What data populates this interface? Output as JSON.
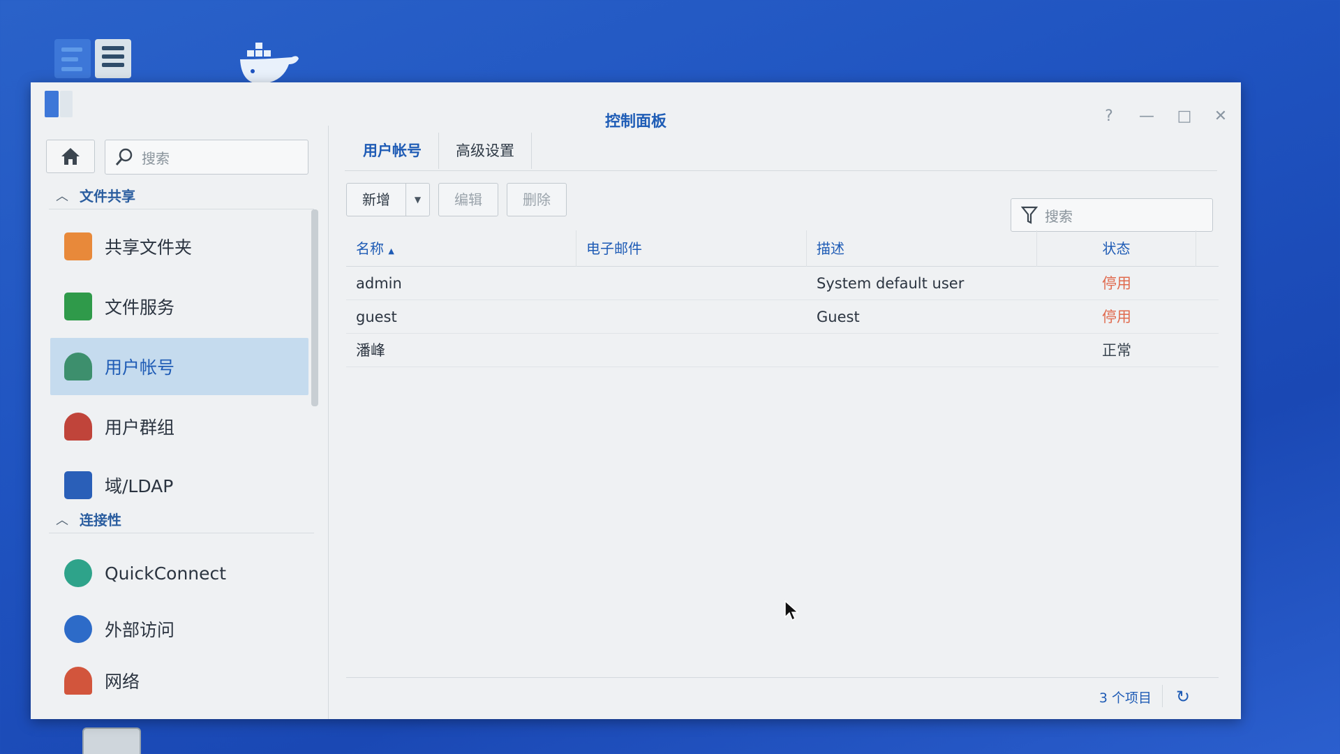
{
  "window": {
    "title": "控制面板"
  },
  "sidebar": {
    "search_placeholder": "搜索",
    "sections": [
      {
        "label": "文件共享"
      },
      {
        "label": "连接性"
      }
    ],
    "items": [
      {
        "label": "共享文件夹",
        "icon": "shared-folder-icon",
        "color": "#e8893a"
      },
      {
        "label": "文件服务",
        "icon": "file-services-icon",
        "color": "#2f9a4a"
      },
      {
        "label": "用户帐号",
        "icon": "user-icon",
        "color": "#3d8f6d",
        "active": true
      },
      {
        "label": "用户群组",
        "icon": "user-group-icon",
        "color": "#c0443a"
      },
      {
        "label": "域/LDAP",
        "icon": "ldap-icon",
        "color": "#2a5fb8"
      },
      {
        "label": "QuickConnect",
        "icon": "quickconnect-icon",
        "color": "#2ea38a"
      },
      {
        "label": "外部访问",
        "icon": "globe-icon",
        "color": "#2d6bc8"
      },
      {
        "label": "网络",
        "icon": "network-icon",
        "color": "#d2553c"
      }
    ]
  },
  "tabs": [
    {
      "label": "用户帐号",
      "active": true
    },
    {
      "label": "高级设置",
      "active": false
    }
  ],
  "toolbar": {
    "add_label": "新增",
    "edit_label": "编辑",
    "delete_label": "删除",
    "filter_placeholder": "搜索"
  },
  "table": {
    "columns": {
      "name": "名称",
      "email": "电子邮件",
      "description": "描述",
      "status": "状态"
    },
    "rows": [
      {
        "name": "admin",
        "email": "",
        "description": "System default user",
        "status": "停用"
      },
      {
        "name": "guest",
        "email": "",
        "description": "Guest",
        "status": "停用"
      },
      {
        "name": "潘峰",
        "email": "",
        "description": "",
        "status": "正常"
      }
    ]
  },
  "footer": {
    "count": "3 个项目"
  },
  "colors": {
    "accent": "#1e5bb5",
    "disabled_status": "#e06a4e",
    "active_item_bg": "#c5dbee"
  }
}
